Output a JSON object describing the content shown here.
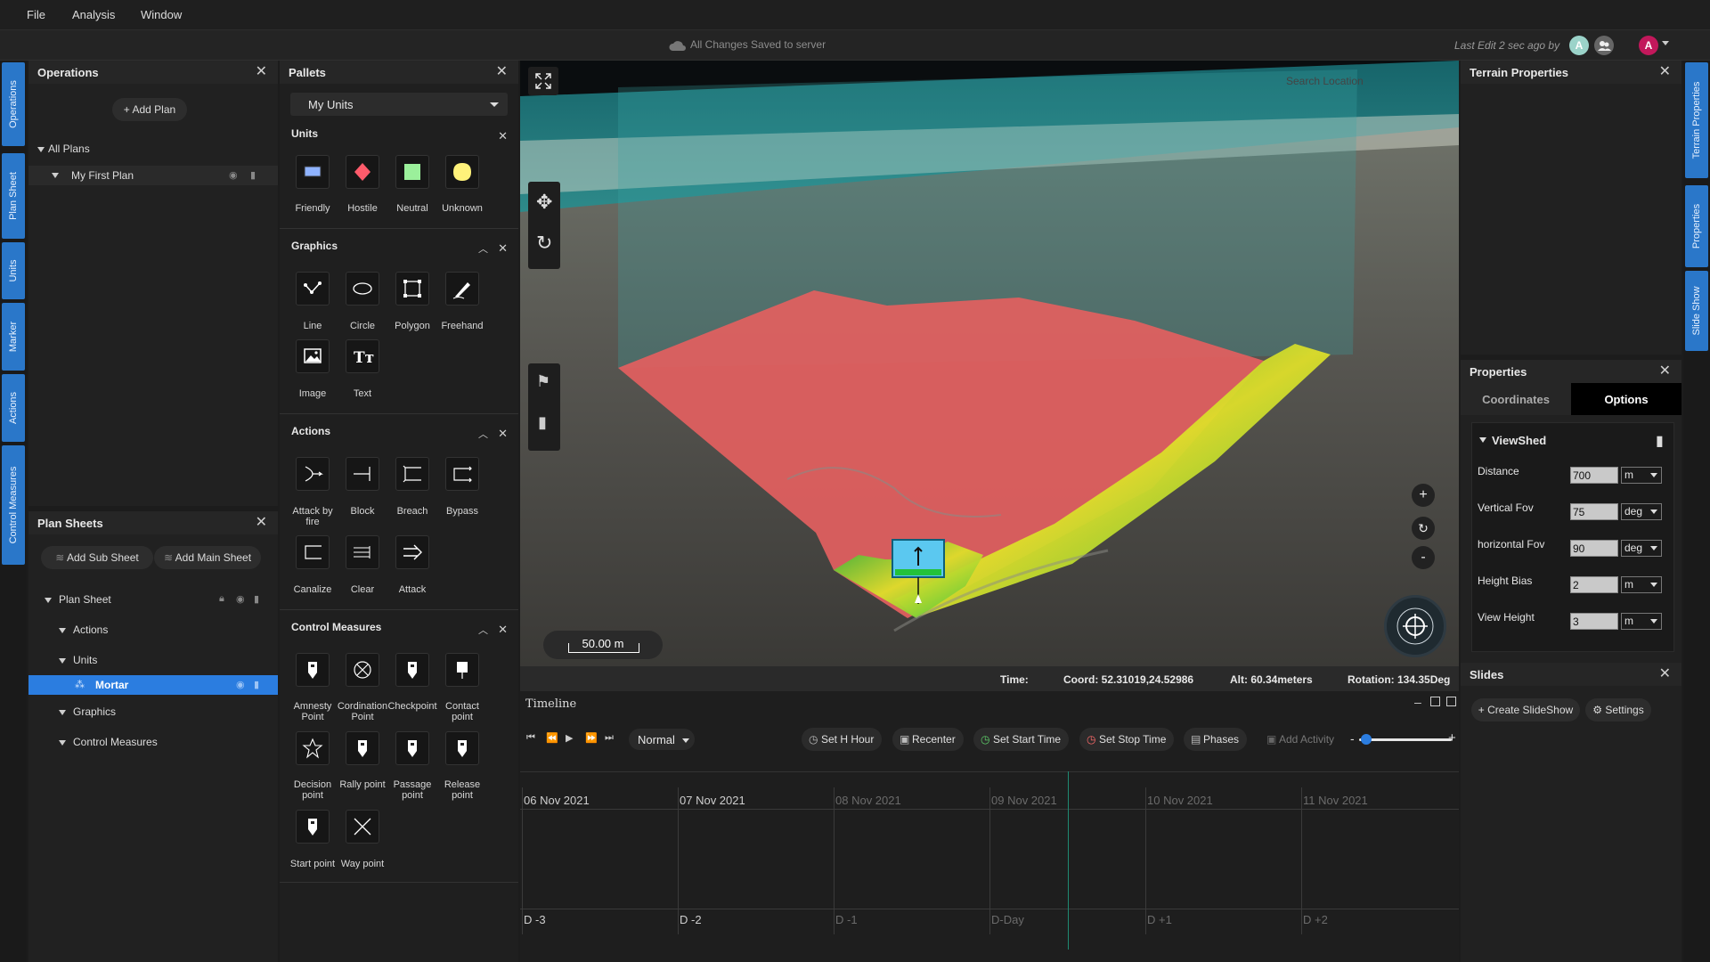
{
  "menu": [
    "File",
    "Analysis",
    "Window"
  ],
  "status": {
    "save_text": "All Changes Saved to server",
    "last_edit": "Last Edit 2 sec ago by",
    "avatar_a": "A",
    "user_avatar": "A"
  },
  "left_tabs": [
    "Operations",
    "Plan Sheet",
    "Units",
    "Marker",
    "Actions",
    "Control Measures"
  ],
  "right_tabs": [
    "Terrain Properties",
    "Properties",
    "Slide Show"
  ],
  "operations": {
    "title": "Operations",
    "add_plan": "Add Plan",
    "all_plans": "All Plans",
    "plan": "My First Plan"
  },
  "plan_sheets": {
    "title": "Plan Sheets",
    "add_sub": "Add Sub Sheet",
    "add_main": "Add Main Sheet",
    "tree": [
      "Plan Sheet",
      "Actions",
      "Units",
      "Mortar",
      "Graphics",
      "Control Measures"
    ]
  },
  "pallets": {
    "title": "Pallets",
    "selected": "My Units",
    "units_title": "Units",
    "units": [
      "Friendly",
      "Hostile",
      "Neutral",
      "Unknown"
    ],
    "graphics_title": "Graphics",
    "graphics": [
      "Line",
      "Circle",
      "Polygon",
      "Freehand",
      "Image",
      "Text"
    ],
    "actions_title": "Actions",
    "actions": [
      "Attack by fire",
      "Block",
      "Breach",
      "Bypass",
      "Canalize",
      "Clear",
      "Attack"
    ],
    "control_title": "Control Measures",
    "control": [
      "Amnesty Point",
      "Cordination Point",
      "Checkpoint",
      "Contact point",
      "Decision point",
      "Rally point",
      "Passage point",
      "Release point",
      "Start point",
      "Way point"
    ]
  },
  "map": {
    "search_placeholder": "Search Location",
    "scale": "50.00 m",
    "zoom_in": "+",
    "zoom_out": "-",
    "colors": {
      "red": "#e05a5a",
      "green": "#3fc94a",
      "yellow": "#e3e03a",
      "unit": "#5bc8f0"
    }
  },
  "infobar": {
    "time": "Time:",
    "coord": "Coord: 52.31019,24.52986",
    "alt": "Alt: 60.34meters",
    "rotation": "Rotation: 134.35Deg"
  },
  "timeline": {
    "title": "Timeline",
    "speed": "Normal",
    "buttons": [
      "Set H Hour",
      "Recenter",
      "Set Start Time",
      "Set Stop Time",
      "Phases",
      "Add Activity"
    ],
    "dates": [
      "06 Nov 2021",
      "07 Nov 2021",
      "08 Nov 2021",
      "09 Nov 2021",
      "10 Nov 2021",
      "11 Nov 2021"
    ],
    "days": [
      "D -3",
      "D -2",
      "D -1",
      "D-Day",
      "D +1",
      "D +2"
    ],
    "slider_minus": "-",
    "slider_plus": "+"
  },
  "terrain": {
    "title": "Terrain Properties"
  },
  "properties": {
    "title": "Properties",
    "tab_coordinates": "Coordinates",
    "tab_options": "Options",
    "section": "ViewShed",
    "rows": [
      {
        "label": "Distance",
        "value": "700",
        "unit": "m"
      },
      {
        "label": "Vertical Fov",
        "value": "75",
        "unit": "deg"
      },
      {
        "label": "horizontal Fov",
        "value": "90",
        "unit": "deg"
      },
      {
        "label": "Height Bias",
        "value": "2",
        "unit": "m"
      },
      {
        "label": "View Height",
        "value": "3",
        "unit": "m"
      }
    ]
  },
  "slides": {
    "title": "Slides",
    "create": "Create SlideShow",
    "settings": "Settings"
  }
}
